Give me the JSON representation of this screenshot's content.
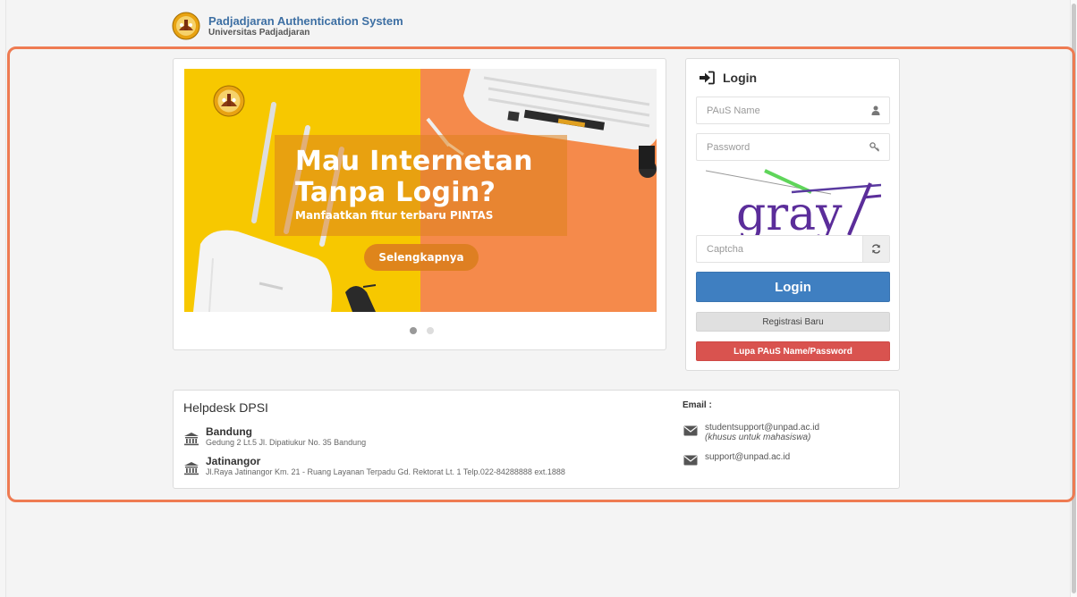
{
  "header": {
    "title": "Padjadjaran Authentication System",
    "subtitle": "Universitas Padjadjaran"
  },
  "carousel": {
    "headline_line1": "Mau Internetan",
    "headline_line2": "Tanpa Login?",
    "subheadline": "Manfaatkan fitur terbaru PINTAS",
    "button_label": "Selengkapnya",
    "slide_count": 2,
    "active_slide": 1
  },
  "login": {
    "title": "Login",
    "username_placeholder": "PAuS Name",
    "password_placeholder": "Password",
    "captcha_text": "gray",
    "captcha_placeholder": "Captcha",
    "login_button": "Login",
    "register_button": "Registrasi Baru",
    "forgot_button": "Lupa PAuS Name/Password"
  },
  "helpdesk": {
    "title": "Helpdesk DPSI",
    "locations": [
      {
        "name": "Bandung",
        "address": "Gedung 2 Lt.5 Jl. Dipatiukur No. 35 Bandung"
      },
      {
        "name": "Jatinangor",
        "address": "Jl.Raya Jatinangor Km. 21 - Ruang Layanan Terpadu Gd. Rektorat Lt. 1 Telp.022-84288888 ext.1888"
      }
    ],
    "email_title": "Email :",
    "emails": [
      {
        "address": "studentsupport@unpad.ac.id",
        "note": "(khusus untuk mahasiswa)"
      },
      {
        "address": "support@unpad.ac.id",
        "note": ""
      }
    ]
  },
  "colors": {
    "brand_blue": "#3d6fa3",
    "login_blue": "#3f7fc1",
    "danger_red": "#d9534f",
    "banner_yellow": "#f7c800",
    "banner_orange": "#f58a4b",
    "highlight": "#ee7b52"
  },
  "icons": {
    "login": "sign-in-icon",
    "username": "user-icon",
    "password": "key-icon",
    "refresh": "refresh-icon",
    "location": "institution-icon",
    "email": "envelope-icon"
  }
}
